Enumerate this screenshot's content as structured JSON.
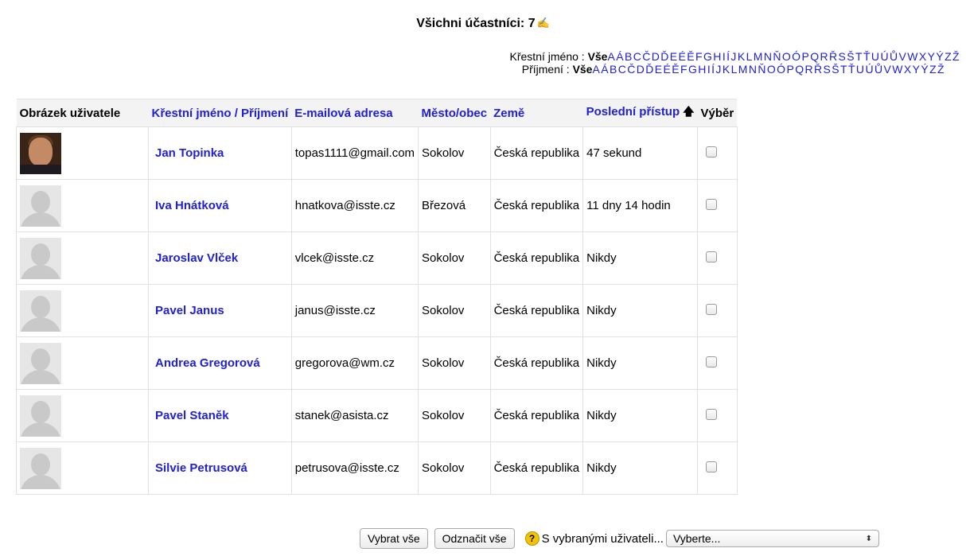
{
  "header": {
    "title": "Všichni účastníci: 7"
  },
  "initials_bar": {
    "first_name_label": "Křestní jméno :",
    "last_name_label": "Příjmení :",
    "all_label": "Vše",
    "letters": [
      "A",
      "Á",
      "B",
      "C",
      "Č",
      "D",
      "Ď",
      "E",
      "É",
      "Ě",
      "F",
      "G",
      "H",
      "I",
      "Í",
      "J",
      "K",
      "L",
      "M",
      "N",
      "Ň",
      "O",
      "Ó",
      "P",
      "Q",
      "R",
      "Ř",
      "S",
      "Š",
      "T",
      "Ť",
      "U",
      "Ú",
      "Ů",
      "V",
      "W",
      "X",
      "Y",
      "Ý",
      "Z",
      "Ž"
    ]
  },
  "table": {
    "headers": {
      "picture": "Obrázek uživatele",
      "first_name": "Křestní jméno",
      "separator": " / ",
      "last_name": "Příjmení",
      "email": "E-mailová adresa",
      "city": "Město/obec",
      "country": "Země",
      "last_access": "Poslední přístup",
      "select": "Výběr"
    },
    "rows": [
      {
        "name": "Jan Topinka",
        "email": "topas1111@gmail.com",
        "city": "Sokolov",
        "country": "Česká republika",
        "last_access": "47 sekund",
        "avatar": "user-photo"
      },
      {
        "name": "Iva Hnátková",
        "email": "hnatkova@isste.cz",
        "city": "Březová",
        "country": "Česká republika",
        "last_access": "11 dny 14 hodin",
        "avatar": "default-avatar"
      },
      {
        "name": "Jaroslav Vlček",
        "email": "vlcek@isste.cz",
        "city": "Sokolov",
        "country": "Česká republika",
        "last_access": "Nikdy",
        "avatar": "default-avatar"
      },
      {
        "name": "Pavel Janus",
        "email": "janus@isste.cz",
        "city": "Sokolov",
        "country": "Česká republika",
        "last_access": "Nikdy",
        "avatar": "default-avatar"
      },
      {
        "name": "Andrea Gregorová",
        "email": "gregorova@wm.cz",
        "city": "Sokolov",
        "country": "Česká republika",
        "last_access": "Nikdy",
        "avatar": "default-avatar"
      },
      {
        "name": "Pavel Staněk",
        "email": "stanek@asista.cz",
        "city": "Sokolov",
        "country": "Česká republika",
        "last_access": "Nikdy",
        "avatar": "default-avatar"
      },
      {
        "name": "Silvie Petrusová",
        "email": "petrusova@isste.cz",
        "city": "Sokolov",
        "country": "Česká republika",
        "last_access": "Nikdy",
        "avatar": "default-avatar"
      }
    ]
  },
  "actions": {
    "select_all": "Vybrat vše",
    "deselect_all": "Odznačit vše",
    "with_selected": "S vybranými uživateli...",
    "dropdown_value": "Vyberte..."
  },
  "colors": {
    "link": "#2020d8",
    "header_bg": "#f3f3f3"
  }
}
